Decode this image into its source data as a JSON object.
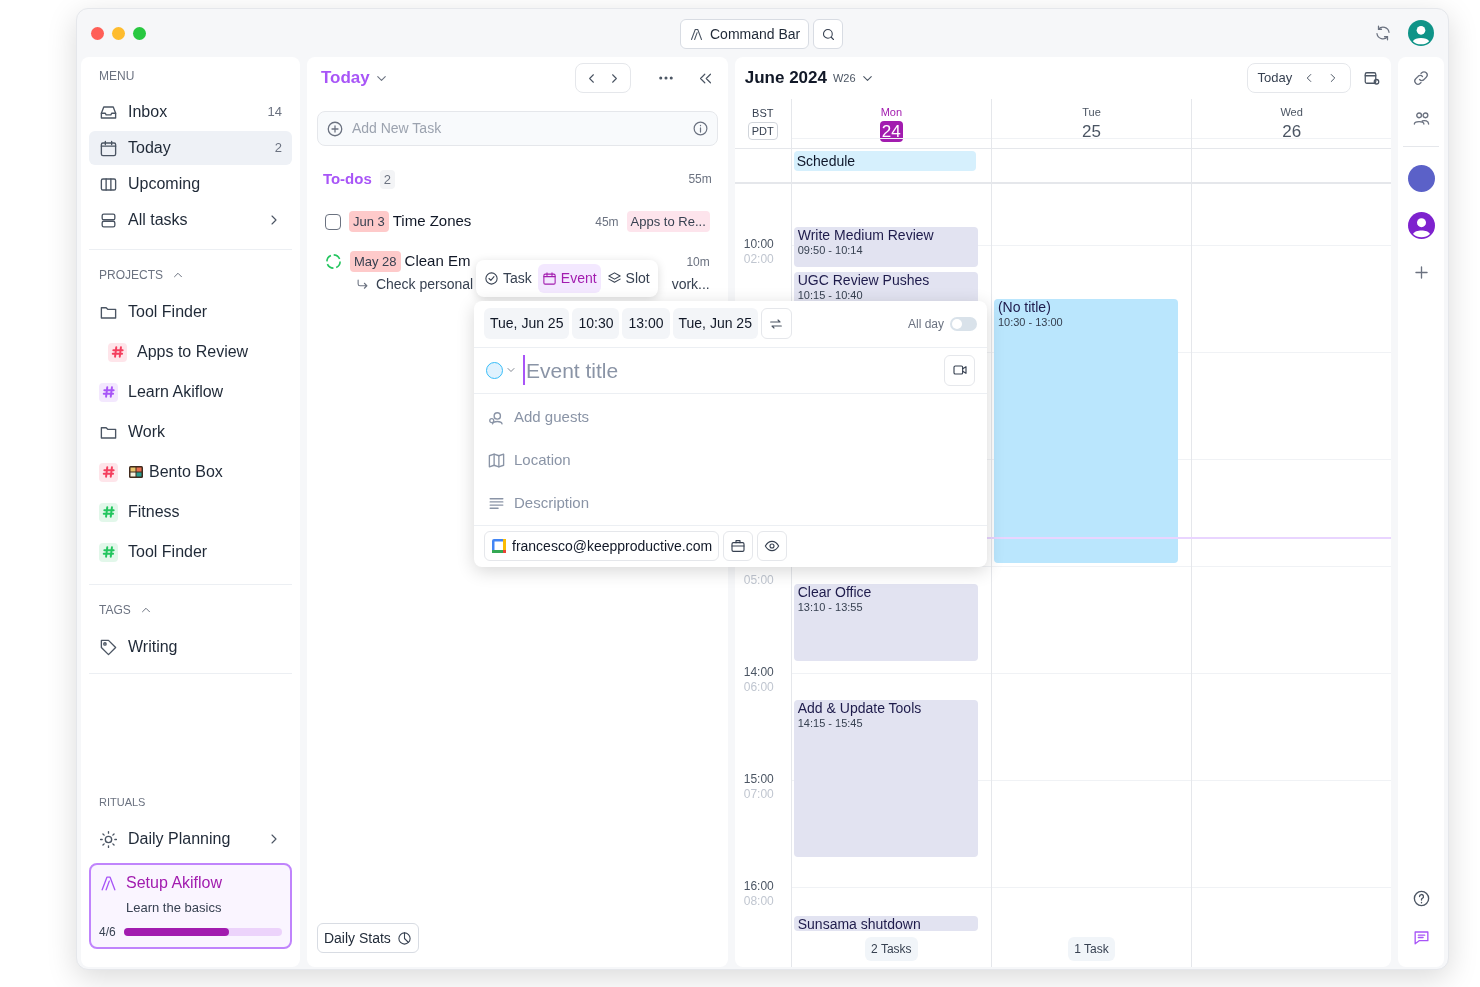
{
  "top_bar": {
    "command_bar": "Command Bar"
  },
  "sidebar": {
    "menu_title": "MENU",
    "menu": [
      {
        "label": "Inbox",
        "count": "14",
        "selected": false
      },
      {
        "label": "Today",
        "count": "2",
        "selected": true
      },
      {
        "label": "Upcoming",
        "selected": false
      },
      {
        "label": "All tasks",
        "selected": false
      }
    ],
    "projects": {
      "title": "PROJECTS",
      "expanded": true,
      "items": [
        {
          "label": "Tool Finder",
          "kind": "folder",
          "children": [
            {
              "label": "Apps to Review",
              "kind": "tag",
              "color": "#f43f5e"
            }
          ]
        },
        {
          "label": "Learn Akiflow",
          "kind": "tag",
          "color": "#a855f7"
        },
        {
          "label": "Work",
          "kind": "folder"
        },
        {
          "label": "Bento Box",
          "kind": "tag",
          "color": "#f43f5e",
          "emoji": true
        },
        {
          "label": "Fitness",
          "kind": "tag",
          "color": "#22c55e"
        },
        {
          "label": "Tool Finder",
          "kind": "tag",
          "color": "#22c55e"
        }
      ]
    },
    "tags": {
      "title": "TAGS",
      "expanded": true,
      "items": [
        {
          "label": "Writing"
        }
      ]
    },
    "rituals": {
      "title": "RITUALS",
      "items": [
        {
          "label": "Daily Planning"
        }
      ]
    },
    "setup": {
      "title": "Setup Akiflow",
      "subtitle": "Learn the basics",
      "progress": "4/6",
      "level": 0.667
    }
  },
  "tasks_panel": {
    "title": "Today",
    "add_placeholder": "Add New Task",
    "section": {
      "title": "To-dos",
      "count": "2",
      "duration": "55m"
    },
    "tasks": [
      {
        "kind": "checkbox",
        "checked": false,
        "date": "Jun 3",
        "title": "Time Zones",
        "duration": "45m",
        "project": "Apps to Re..."
      },
      {
        "kind": "recurring",
        "date": "May 28",
        "title": "Clean Em",
        "duration": "10m",
        "subtask": "Check personal",
        "subtask_end": "vork..."
      }
    ],
    "daily_stats": "Daily Stats"
  },
  "composer": {
    "tabs": [
      {
        "label": "Task",
        "selected": false
      },
      {
        "label": "Event",
        "selected": true
      },
      {
        "label": "Slot",
        "selected": false
      }
    ],
    "start_date": "Tue, Jun 25",
    "start_time": "10:30",
    "end_time": "13:00",
    "end_date": "Tue, Jun 25",
    "all_day": {
      "label": "All day",
      "on": false
    },
    "title_placeholder": "Event title",
    "fields": [
      {
        "placeholder": "Add guests"
      },
      {
        "placeholder": "Location"
      },
      {
        "placeholder": "Description"
      }
    ],
    "account": "francesco@keepproductive.com"
  },
  "calendar": {
    "month": "June 2024",
    "week": "W26",
    "today_button": "Today",
    "timezones": [
      "BST",
      "PDT"
    ],
    "hours": [
      {
        "primary": "10:00",
        "secondary": "02:00"
      },
      {
        "secondary": "05:00"
      },
      {
        "primary": "14:00",
        "secondary": "06:00"
      },
      {
        "primary": "15:00",
        "secondary": "07:00"
      },
      {
        "primary": "16:00",
        "secondary": "08:00"
      }
    ],
    "days": [
      {
        "weekday": "Mon",
        "date": "24",
        "selected": true,
        "all_day": [
          "Schedule"
        ],
        "events": [
          {
            "kind": "task",
            "title": "Write Medium Review",
            "time": "09:50 - 10:14"
          },
          {
            "kind": "task",
            "title": "UGC Review Pushes",
            "time": "10:15 - 10:40"
          },
          {
            "kind": "task",
            "title": "Clear Office",
            "time": "13:10 - 13:55"
          },
          {
            "kind": "task",
            "title": "Add & Update Tools",
            "time": "14:15 - 15:45"
          },
          {
            "kind": "task",
            "title": "Sunsama shutdown"
          }
        ],
        "footer": "2 Tasks"
      },
      {
        "weekday": "Tue",
        "date": "25",
        "selected": false,
        "events": [
          {
            "kind": "event",
            "title": "(No title)",
            "time": "10:30 - 13:00"
          }
        ],
        "footer": "1 Task"
      },
      {
        "weekday": "Wed",
        "date": "26",
        "selected": false
      }
    ]
  }
}
